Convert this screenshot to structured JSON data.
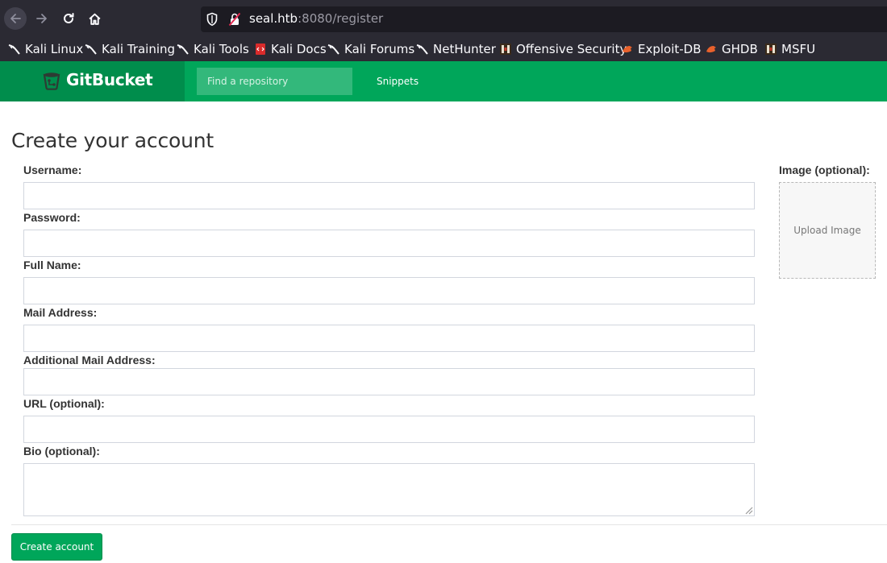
{
  "browser": {
    "url_host": "seal.htb",
    "url_rest": ":8080/register",
    "bookmarks": [
      {
        "label": "Kali Linux",
        "icon": "kali-dragon-icon"
      },
      {
        "label": "Kali Training",
        "icon": "kali-dragon-icon"
      },
      {
        "label": "Kali Tools",
        "icon": "kali-dragon-icon"
      },
      {
        "label": "Kali Docs",
        "icon": "kali-docs-icon"
      },
      {
        "label": "Kali Forums",
        "icon": "kali-dragon-icon"
      },
      {
        "label": "NetHunter",
        "icon": "kali-dragon-icon"
      },
      {
        "label": "Offensive Security",
        "icon": "offsec-icon"
      },
      {
        "label": "Exploit-DB",
        "icon": "exploitdb-icon"
      },
      {
        "label": "GHDB",
        "icon": "exploitdb-icon"
      },
      {
        "label": "MSFU",
        "icon": "offsec-icon"
      }
    ]
  },
  "header": {
    "brand": "GitBucket",
    "search_placeholder": "Find a repository",
    "nav_snippets": "Snippets"
  },
  "form": {
    "title": "Create your account",
    "username_label": "Username:",
    "password_label": "Password:",
    "fullname_label": "Full Name:",
    "mail_label": "Mail Address:",
    "extra_mail_label": "Additional Mail Address:",
    "url_label": "URL (optional):",
    "bio_label": "Bio (optional):",
    "image_label": "Image (optional):",
    "upload_text": "Upload Image",
    "submit_label": "Create account"
  },
  "colors": {
    "header_green": "#00a65a",
    "brand_green": "#008d4c",
    "browser_dark": "#2b2a33"
  }
}
